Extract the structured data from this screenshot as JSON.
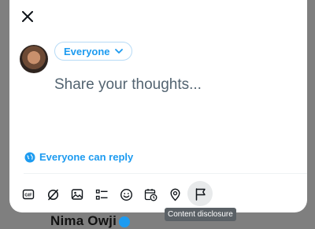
{
  "audience": {
    "label": "Everyone"
  },
  "composer": {
    "placeholder": "Share your thoughts..."
  },
  "reply_setting": {
    "label": "Everyone can reply"
  },
  "toolbar": {
    "items": [
      {
        "icon": "gif-icon",
        "label": "GIF"
      },
      {
        "icon": "grok-icon"
      },
      {
        "icon": "media-icon"
      },
      {
        "icon": "poll-icon"
      },
      {
        "icon": "emoji-icon"
      },
      {
        "icon": "schedule-icon"
      },
      {
        "icon": "location-icon"
      },
      {
        "icon": "flag-icon",
        "tooltip": "Content disclosure"
      }
    ]
  },
  "background": {
    "author_name": "Nima Owji"
  },
  "colors": {
    "accent": "#1d9bf0",
    "text": "#0f1419",
    "muted": "#536471",
    "overlay": "#7f7f7f"
  }
}
